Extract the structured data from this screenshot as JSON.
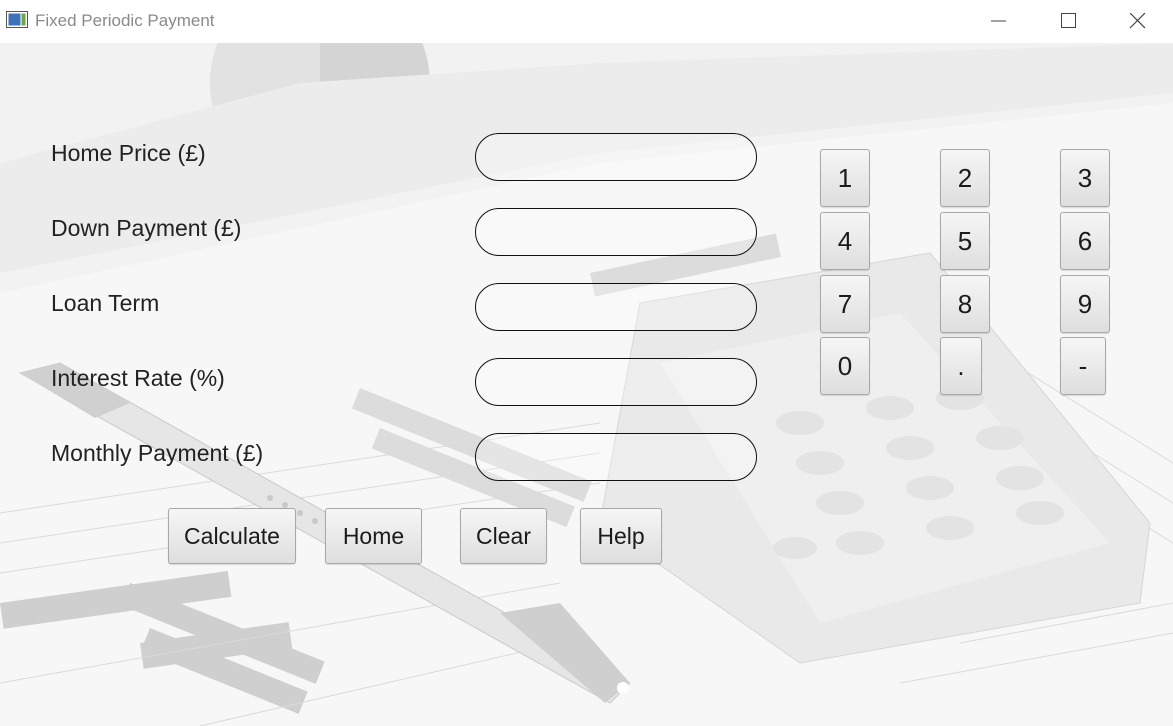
{
  "window": {
    "title": "Fixed Periodic Payment",
    "controls": [
      "minimize-icon",
      "maximize-icon",
      "close-icon"
    ]
  },
  "form": {
    "fields": [
      {
        "label": "Home Price (£)",
        "value": ""
      },
      {
        "label": "Down Payment (£)",
        "value": ""
      },
      {
        "label": "Loan Term",
        "value": ""
      },
      {
        "label": "Interest Rate (%)",
        "value": ""
      },
      {
        "label": "Monthly Payment (£)",
        "value": ""
      }
    ]
  },
  "keypad": {
    "keys": [
      "1",
      "2",
      "3",
      "4",
      "5",
      "6",
      "7",
      "8",
      "9",
      "0",
      ".",
      "-"
    ]
  },
  "actions": {
    "calculate": "Calculate",
    "home": "Home",
    "clear": "Clear",
    "help": "Help"
  },
  "background": {
    "description_icon": "financial-charts-calculator-pen-photo"
  }
}
